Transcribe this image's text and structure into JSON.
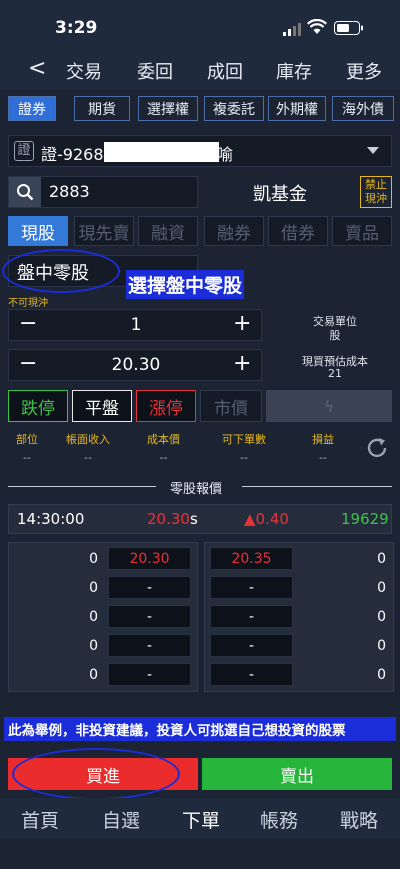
{
  "status_bar": {
    "time": "3:29"
  },
  "nav": {
    "back": "<",
    "tabs": [
      "交易",
      "委回",
      "成回",
      "庫存",
      "更多"
    ]
  },
  "product_tabs": [
    "證券",
    "期貨",
    "選擇權",
    "複委託",
    "外期權",
    "海外債"
  ],
  "account": {
    "badge": "證",
    "label": "證-9268",
    "suffix": "喻"
  },
  "search": {
    "code": "2883"
  },
  "stock": {
    "name": "凱基金",
    "tag": "禁止\n現沖"
  },
  "trade_types": [
    "現股",
    "現先賣",
    "融資",
    "融券",
    "借券",
    "賣品"
  ],
  "session": {
    "value": "盤中零股",
    "annotation": "選擇盤中零股"
  },
  "no_daytrade": "不可現沖",
  "quantity": {
    "value": "1",
    "unit_label": "交易單位",
    "unit_value": "股",
    "minus": "−",
    "plus": "+"
  },
  "price": {
    "value": "20.30",
    "cost_label": "現買預估成本",
    "cost_value": "21",
    "minus": "−",
    "plus": "+"
  },
  "price_buttons": [
    "跌停",
    "平盤",
    "漲停",
    "市價"
  ],
  "position": {
    "headers": [
      "部位",
      "帳面收入",
      "成本價",
      "可下單數",
      "損益"
    ],
    "values": [
      "--",
      "--",
      "--",
      "--",
      "--"
    ]
  },
  "odd_lot_title": "零股報價",
  "quote": {
    "time": "14:30:00",
    "price": "20.30",
    "suffix": "s",
    "change": "▲0.40",
    "volume": "19629"
  },
  "book": {
    "bids": [
      {
        "qty": "0",
        "price": "20.30"
      },
      {
        "qty": "0",
        "price": "-"
      },
      {
        "qty": "0",
        "price": "-"
      },
      {
        "qty": "0",
        "price": "-"
      },
      {
        "qty": "0",
        "price": "-"
      }
    ],
    "asks": [
      {
        "qty": "0",
        "price": "20.35"
      },
      {
        "qty": "0",
        "price": "-"
      },
      {
        "qty": "0",
        "price": "-"
      },
      {
        "qty": "0",
        "price": "-"
      },
      {
        "qty": "0",
        "price": "-"
      }
    ]
  },
  "disclaimer": "此為舉例，非投資建議，投資人可挑選自己想投資的股票",
  "actions": {
    "buy": "買進",
    "sell": "賣出"
  },
  "bottom_tabs": [
    "首頁",
    "自選",
    "下單",
    "帳務",
    "戰略"
  ],
  "colors": {
    "accent": "#2e6ed6",
    "up": "#e6333a",
    "down": "#3fc14a",
    "buy_bg": "#ea2c2c",
    "sell_bg": "#26b43a",
    "annotation": "#1a2dd8"
  }
}
